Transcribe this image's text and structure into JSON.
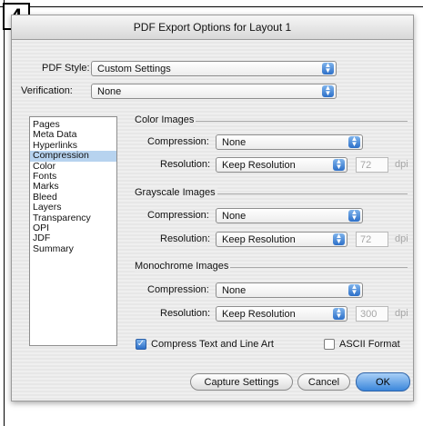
{
  "step_badge": "4",
  "dialog": {
    "title": "PDF Export Options for Layout 1"
  },
  "pdf_style": {
    "label": "PDF Style:",
    "value": "Custom Settings"
  },
  "verification": {
    "label": "Verification:",
    "value": "None"
  },
  "sidebar": {
    "items": [
      "Pages",
      "Meta Data",
      "Hyperlinks",
      "Compression",
      "Color",
      "Fonts",
      "Marks",
      "Bleed",
      "Layers",
      "Transparency",
      "OPI",
      "JDF",
      "Summary"
    ],
    "selected": "Compression"
  },
  "color_images": {
    "title": "Color Images",
    "compression_label": "Compression:",
    "compression": "None",
    "resolution_label": "Resolution:",
    "resolution": "Keep Resolution",
    "dpi_value": "72",
    "dpi_unit": "dpi"
  },
  "grayscale_images": {
    "title": "Grayscale Images",
    "compression_label": "Compression:",
    "compression": "None",
    "resolution_label": "Resolution:",
    "resolution": "Keep Resolution",
    "dpi_value": "72",
    "dpi_unit": "dpi"
  },
  "monochrome_images": {
    "title": "Monochrome Images",
    "compression_label": "Compression:",
    "compression": "None",
    "resolution_label": "Resolution:",
    "resolution": "Keep Resolution",
    "dpi_value": "300",
    "dpi_unit": "dpi"
  },
  "options": {
    "compress_text": {
      "label": "Compress Text and Line Art",
      "checked": true
    },
    "ascii_format": {
      "label": "ASCII Format",
      "checked": false
    }
  },
  "buttons": {
    "capture": "Capture Settings",
    "cancel": "Cancel",
    "ok": "OK"
  },
  "colors": {
    "accent": "#3b86db",
    "selection": "#b7d3ef"
  }
}
